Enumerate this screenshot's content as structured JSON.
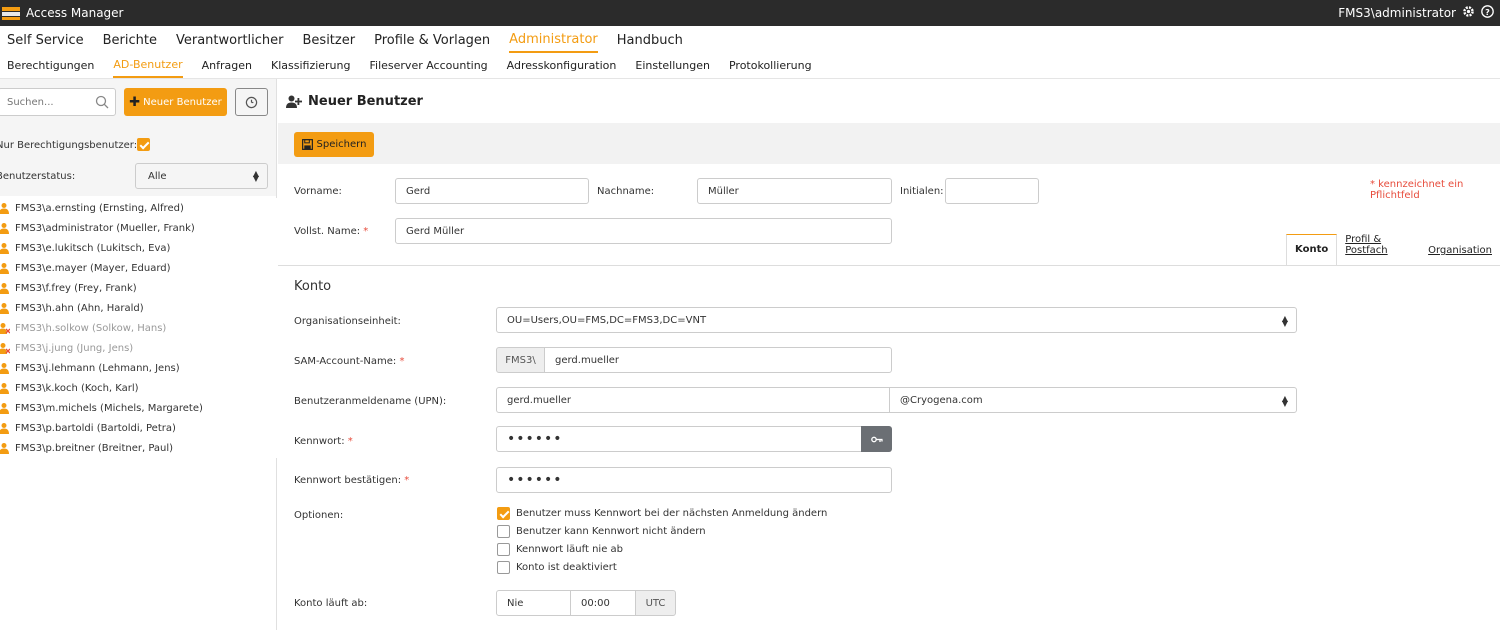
{
  "app": {
    "title": "Access Manager",
    "user": "FMS3\\administrator"
  },
  "main_nav": [
    {
      "label": "Self Service"
    },
    {
      "label": "Berichte"
    },
    {
      "label": "Verantwortlicher"
    },
    {
      "label": "Besitzer"
    },
    {
      "label": "Profile & Vorlagen"
    },
    {
      "label": "Administrator",
      "active": true
    },
    {
      "label": "Handbuch"
    }
  ],
  "sub_nav": [
    {
      "label": "Berechtigungen"
    },
    {
      "label": "AD-Benutzer",
      "active": true
    },
    {
      "label": "Anfragen"
    },
    {
      "label": "Klassifizierung"
    },
    {
      "label": "Fileserver Accounting"
    },
    {
      "label": "Adresskonfiguration"
    },
    {
      "label": "Einstellungen"
    },
    {
      "label": "Protokollierung"
    }
  ],
  "sidebar": {
    "search_placeholder": "Suchen...",
    "new_user_label": "Neuer Benutzer",
    "only_permission_users_label": "Nur Berechtigungsbenutzer:",
    "user_status_label": "Benutzerstatus:",
    "user_status_value": "Alle",
    "users": [
      {
        "label": "FMS3\\a.ernsting (Ernsting, Alfred)",
        "disabled": false
      },
      {
        "label": "FMS3\\administrator (Mueller, Frank)",
        "disabled": false
      },
      {
        "label": "FMS3\\e.lukitsch (Lukitsch, Eva)",
        "disabled": false
      },
      {
        "label": "FMS3\\e.mayer (Mayer, Eduard)",
        "disabled": false
      },
      {
        "label": "FMS3\\f.frey (Frey, Frank)",
        "disabled": false
      },
      {
        "label": "FMS3\\h.ahn (Ahn, Harald)",
        "disabled": false
      },
      {
        "label": "FMS3\\h.solkow (Solkow, Hans)",
        "disabled": true
      },
      {
        "label": "FMS3\\j.jung (Jung, Jens)",
        "disabled": true
      },
      {
        "label": "FMS3\\j.lehmann (Lehmann, Jens)",
        "disabled": false
      },
      {
        "label": "FMS3\\k.koch (Koch, Karl)",
        "disabled": false
      },
      {
        "label": "FMS3\\m.michels (Michels, Margarete)",
        "disabled": false
      },
      {
        "label": "FMS3\\p.bartoldi (Bartoldi, Petra)",
        "disabled": false
      },
      {
        "label": "FMS3\\p.breitner (Breitner, Paul)",
        "disabled": false
      }
    ]
  },
  "form": {
    "title": "Neuer Benutzer",
    "save_label": "Speichern",
    "required_note": "* kennzeichnet ein Pflichtfeld",
    "firstname_label": "Vorname:",
    "firstname_value": "Gerd",
    "lastname_label": "Nachname:",
    "lastname_value": "Müller",
    "initials_label": "Initialen:",
    "initials_value": "",
    "fullname_label": "Vollst. Name:",
    "fullname_value": "Gerd Müller",
    "tabs": [
      {
        "label": "Konto",
        "active": true
      },
      {
        "label": "Profil & Postfach"
      },
      {
        "label": "Organisation"
      }
    ],
    "section_title": "Konto",
    "ou_label": "Organisationseinheit:",
    "ou_value": "OU=Users,OU=FMS,DC=FMS3,DC=VNT",
    "sam_label": "SAM-Account-Name:",
    "sam_prefix": "FMS3\\",
    "sam_value": "gerd.mueller",
    "upn_label": "Benutzeranmeldename (UPN):",
    "upn_value": "gerd.mueller",
    "upn_domain": "@Cryogena.com",
    "password_label": "Kennwort:",
    "password_value": "••••••",
    "password_confirm_label": "Kennwort bestätigen:",
    "password_confirm_value": "••••••",
    "options_label": "Optionen:",
    "options": [
      {
        "label": "Benutzer muss Kennwort bei der nächsten Anmeldung ändern",
        "checked": true
      },
      {
        "label": "Benutzer kann Kennwort nicht ändern",
        "checked": false
      },
      {
        "label": "Kennwort läuft nie ab",
        "checked": false
      },
      {
        "label": "Konto ist deaktiviert",
        "checked": false
      }
    ],
    "expires_label": "Konto läuft ab:",
    "expires_date": "Nie",
    "expires_time": "00:00",
    "expires_tz": "UTC",
    "req_mark": "*"
  },
  "colors": {
    "accent": "#f39c12",
    "titlebar": "#2b2b2b",
    "required": "#e74c3c"
  }
}
